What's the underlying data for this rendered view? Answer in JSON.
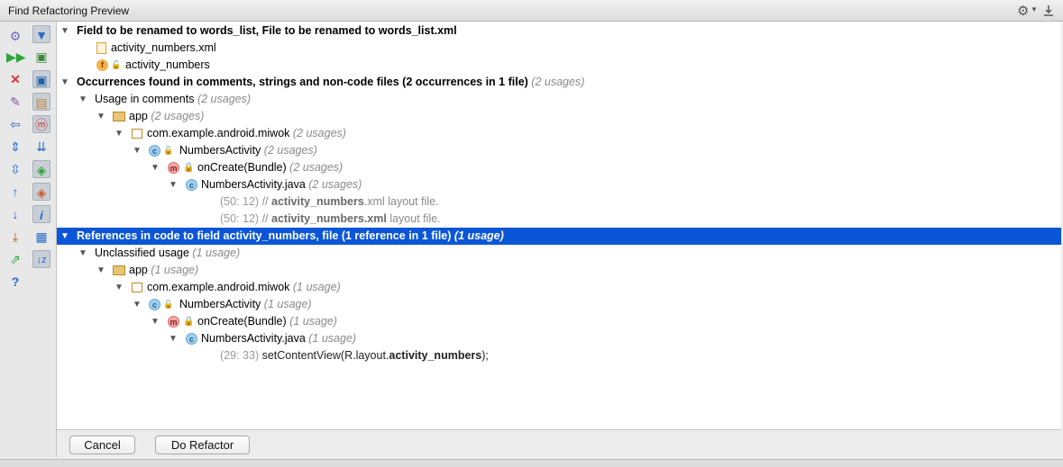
{
  "window": {
    "title": "Find Refactoring Preview"
  },
  "tree": {
    "field_header": "Field to be renamed to words_list, File to be renamed to words_list.xml",
    "file_item": "activity_numbers.xml",
    "field_item": "activity_numbers",
    "occurrences": {
      "label": "Occurrences found in comments, strings and non-code files  (2 occurrences in 1 file)",
      "usages": "(2 usages)",
      "group_label": "Usage in comments",
      "group_usages": "(2 usages)",
      "module": "app",
      "module_usages": "(2 usages)",
      "package": "com.example.android.miwok",
      "package_usages": "(2 usages)",
      "class": "NumbersActivity",
      "class_usages": "(2 usages)",
      "method": "onCreate(Bundle)",
      "method_usages": "(2 usages)",
      "file": "NumbersActivity.java",
      "file_usages": "(2 usages)",
      "lines": [
        {
          "loc": "(50: 12)",
          "pre": "// ",
          "match": "activity_numbers",
          "post": ".xml layout file."
        },
        {
          "loc": "(50: 12)",
          "pre": "// ",
          "match": "activity_numbers.xml",
          "post": " layout file."
        }
      ]
    },
    "references": {
      "label": "References in code to field activity_numbers, file  (1 reference in 1 file)",
      "usages": "(1 usage)",
      "group_label": "Unclassified usage",
      "group_usages": "(1 usage)",
      "module": "app",
      "module_usages": "(1 usage)",
      "package": "com.example.android.miwok",
      "package_usages": "(1 usage)",
      "class": "NumbersActivity",
      "class_usages": "(1 usage)",
      "method": "onCreate(Bundle)",
      "method_usages": "(1 usage)",
      "file": "NumbersActivity.java",
      "file_usages": "(1 usage)",
      "line": {
        "loc": "(29: 33)",
        "pre": "setContentView(R.layout.",
        "match": "activity_numbers",
        "post": ");"
      }
    }
  },
  "buttons": {
    "cancel": "Cancel",
    "do_refactor": "Do Refactor"
  },
  "colors": {
    "selection": "#0a56d6",
    "toolbar_bg": "#e8e8e8"
  }
}
